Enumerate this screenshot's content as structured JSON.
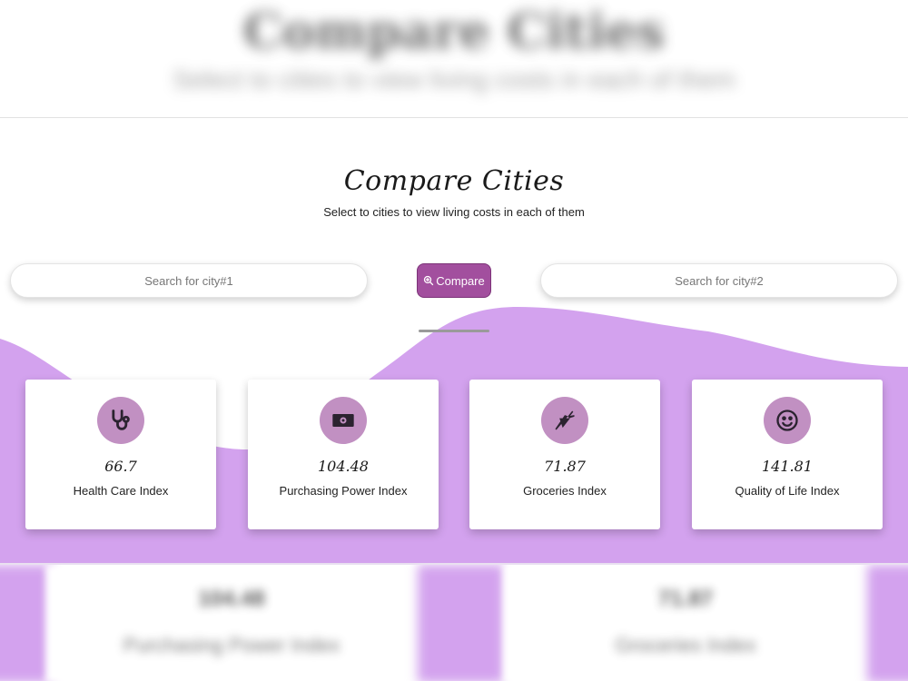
{
  "background_page": {
    "title": "Compare Cities",
    "subtitle": "Select to cities to view living costs in each of them"
  },
  "hero": {
    "title": "Compare Cities",
    "subtitle": "Select to cities to view living costs in each of them"
  },
  "search": {
    "city1_placeholder": "Search for city#1",
    "city1_value": "",
    "city2_placeholder": "Search for city#2",
    "city2_value": ""
  },
  "compare_button": {
    "label": "Compare",
    "icon": "zoom-search-icon"
  },
  "colors": {
    "accent": "#a24f9e",
    "wave": "#d3a2ee",
    "icon_circle": "#c190c2"
  },
  "cards": [
    {
      "value": "66.7",
      "label": "Health Care Index",
      "icon": "stethoscope-icon"
    },
    {
      "value": "104.48",
      "label": "Purchasing Power Index",
      "icon": "money-bill-icon"
    },
    {
      "value": "71.87",
      "label": "Groceries Index",
      "icon": "carrot-icon"
    },
    {
      "value": "141.81",
      "label": "Quality of Life Index",
      "icon": "smile-icon"
    }
  ],
  "bottom_blurred": [
    {
      "value": "104.48",
      "label": "Purchasing Power Index"
    },
    {
      "value": "71.87",
      "label": "Groceries Index"
    }
  ]
}
